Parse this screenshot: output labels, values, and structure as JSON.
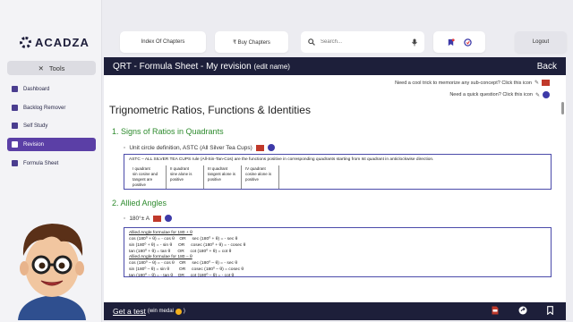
{
  "brand": {
    "name": "ACADZA"
  },
  "sidebar": {
    "tools_label": "Tools",
    "items": [
      {
        "label": "Dashboard",
        "icon": "dashboard-icon"
      },
      {
        "label": "Backlog Remover",
        "icon": "backlog-icon"
      },
      {
        "label": "Self Study",
        "icon": "book-icon"
      },
      {
        "label": "Revision",
        "icon": "revision-icon",
        "active": true
      },
      {
        "label": "Formula Sheet",
        "icon": "formula-icon"
      }
    ]
  },
  "topbar": {
    "index_label": "Index Of Chapters",
    "buy_label": "₹ Buy Chapters",
    "search_placeholder": "Search...",
    "logout_label": "Logout"
  },
  "panel": {
    "header_title": "QRT - Formula Sheet - My revision",
    "header_edit": "(edit name)",
    "back_label": "Back",
    "hint_1": "Need a cool trick to memorize any sub-concept? Click this icon",
    "hint_2": "Need a quick question? Click this icon",
    "page_title": "Trignometric Ratios, Functions & Identities",
    "sections": [
      {
        "title": "1. Signs of Ratios in Quadrants",
        "sub_label": "Unit circle definition, ASTC (All Silver Tea Cups)",
        "box_intro": "ASTC – ALL SILVER TEA CUPS rule (All-Sin-Tan-Cos) are the functions positive in corresponding quadrants starting from Ist quadrant in anticlockwise direction.",
        "quadrants": [
          {
            "l1": "I quadrant",
            "l2": "sin cosine and",
            "l3": "tangent are positive"
          },
          {
            "l1": "II quadrant",
            "l2": "sine alone is",
            "l3": "positive"
          },
          {
            "l1": "III quadrant",
            "l2": "tangent alone is",
            "l3": "positive"
          },
          {
            "l1": "IV quadrant",
            "l2": "cosine alone is",
            "l3": "positive"
          }
        ]
      },
      {
        "title": "2. Allied Angles",
        "sub_label": "180°± A",
        "head_1": "Allied Angle formulae for 180 + θ",
        "lines_1": [
          "cos (180⁰ + θ) = - cos θ    OR     sec (180⁰ + θ) = - sec θ",
          "sin (180⁰ + θ) = - sin θ     OR     cosec (180⁰ + θ) = - cosec θ",
          "tan (180⁰ + θ) = tan θ      OR     cot (180⁰ + θ) = cot θ"
        ],
        "head_2": "Allied Angle formulae for 180 – θ",
        "lines_2": [
          "cos (180⁰ – θ) = - cos θ    OR     sec (180⁰ – θ) = - sec θ",
          "sin (180⁰ – θ) = sin θ        OR     cosec (180⁰ – θ) = cosec θ",
          "tan (180⁰ – θ) = - tan θ    OR     cot (180⁰ – θ) = - cot θ"
        ]
      }
    ]
  },
  "bottom": {
    "test_label": "Get a test",
    "test_sub": "(win medal",
    "test_sub_end": ")"
  },
  "colors": {
    "accent": "#5b3fa6",
    "dark_bar": "#1d1f3a",
    "section_green": "#2e8b2e",
    "red_badge": "#c0392b",
    "blue_badge": "#3d3aa8"
  }
}
